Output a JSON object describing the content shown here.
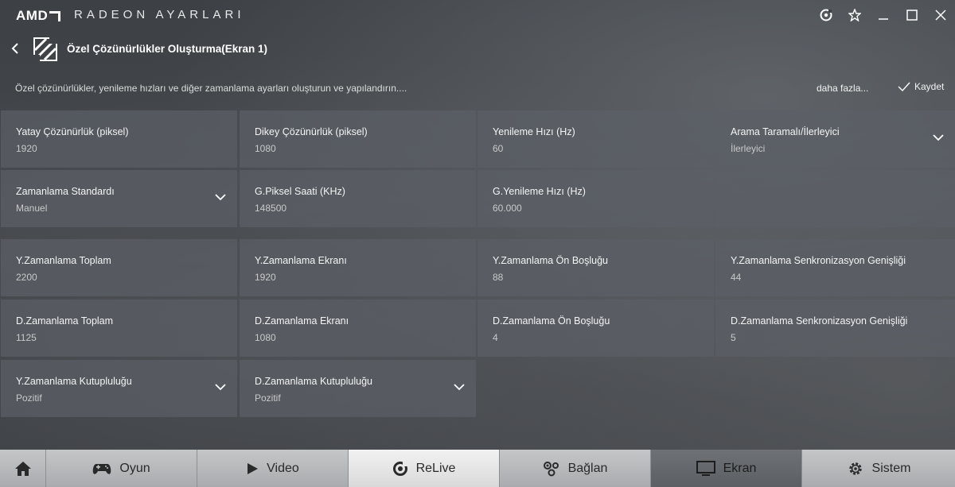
{
  "app": {
    "brand": "AMD",
    "title": "RADEON AYARLARI"
  },
  "window_controls": [
    {
      "name": "radeon-circle-icon"
    },
    {
      "name": "star-icon"
    },
    {
      "name": "minimize-icon"
    },
    {
      "name": "maximize-icon"
    },
    {
      "name": "close-icon"
    }
  ],
  "header": {
    "title": "Özel Çözünürlükler Oluşturma(Ekran 1)",
    "description": "Özel çözünürlükler, yenileme hızları ve diğer zamanlama ayarları oluşturun ve yapılandırın....",
    "more_label": "daha fazla...",
    "save_label": "Kaydet"
  },
  "fields": [
    {
      "label": "Yatay Çözünürlük (piksel)",
      "value": "1920",
      "dropdown": false
    },
    {
      "label": "Dikey Çözünürlük (piksel)",
      "value": "1080",
      "dropdown": false
    },
    {
      "label": "Yenileme Hızı (Hz)",
      "value": "60",
      "dropdown": false
    },
    {
      "label": "Arama Taramalı/İlerleyici",
      "value": "İlerleyici",
      "dropdown": true
    },
    {
      "label": "Zamanlama Standardı",
      "value": "Manuel",
      "dropdown": true
    },
    {
      "label": "G.Piksel Saati (KHz)",
      "value": "148500",
      "dropdown": false
    },
    {
      "label": "G.Yenileme Hızı (Hz)",
      "value": "60.000",
      "dropdown": false
    },
    {
      "label": "Y.Zamanlama Toplam",
      "value": "2200",
      "dropdown": false
    },
    {
      "label": "Y.Zamanlama Ekranı",
      "value": "1920",
      "dropdown": false
    },
    {
      "label": "Y.Zamanlama Ön Boşluğu",
      "value": "88",
      "dropdown": false
    },
    {
      "label": "Y.Zamanlama Senkronizasyon Genişliği",
      "value": "44",
      "dropdown": false
    },
    {
      "label": "D.Zamanlama Toplam",
      "value": "1125",
      "dropdown": false
    },
    {
      "label": "D.Zamanlama Ekranı",
      "value": "1080",
      "dropdown": false
    },
    {
      "label": "D.Zamanlama Ön Boşluğu",
      "value": "4",
      "dropdown": false
    },
    {
      "label": "D.Zamanlama Senkronizasyon Genişliği",
      "value": "5",
      "dropdown": false
    },
    {
      "label": "Y.Zamanlama Kutupluluğu",
      "value": "Pozitif",
      "dropdown": true
    },
    {
      "label": "D.Zamanlama Kutupluluğu",
      "value": "Pozitif",
      "dropdown": true
    }
  ],
  "nav": [
    {
      "label": "",
      "icon": "home-icon"
    },
    {
      "label": "Oyun",
      "icon": "gamepad-icon"
    },
    {
      "label": "Video",
      "icon": "play-icon"
    },
    {
      "label": "ReLive",
      "icon": "relive-icon",
      "state": "highlighted"
    },
    {
      "label": "Bağlan",
      "icon": "connect-icon"
    },
    {
      "label": "Ekran",
      "icon": "monitor-icon",
      "state": "selected"
    },
    {
      "label": "Sistem",
      "icon": "gear-icon"
    }
  ]
}
